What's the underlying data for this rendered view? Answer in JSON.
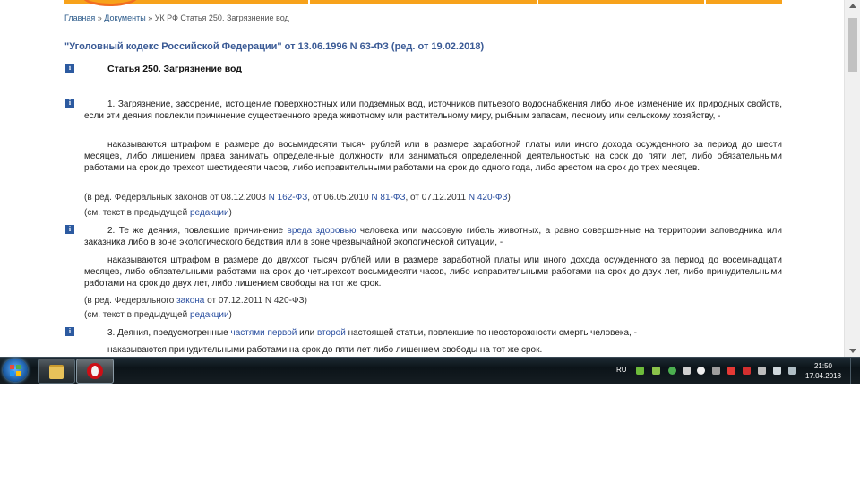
{
  "breadcrumb": {
    "home": "Главная",
    "sep1": " » ",
    "documents": "Документы",
    "sep2": " » ",
    "current": "УК РФ Статья 250. Загрязнение вод"
  },
  "doc_title": "\"Уголовный кодекс Российской Федерации\" от 13.06.1996 N 63-ФЗ (ред. от 19.02.2018)",
  "article_title": "Статья 250. Загрязнение вод",
  "p1": "1. Загрязнение, засорение, истощение поверхностных или подземных вод, источников питьевого водоснабжения либо иное изменение их природных свойств, если эти деяния повлекли причинение существенного вреда животному или растительному миру, рыбным запасам, лесному или сельскому хозяйству, -",
  "p1_sanction": "наказываются штрафом в размере до восьмидесяти тысяч рублей или в размере заработной платы или иного дохода осужденного за период до шести месяцев, либо лишением права занимать определенные должности или заниматься определенной деятельностью на срок до пяти лет, либо обязательными работами на срок до трехсот шестидесяти часов, либо исправительными работами на срок до одного года, либо арестом на срок до трех месяцев.",
  "note1": {
    "prefix": "(в ред. Федеральных законов от 08.12.2003 ",
    "link1": "N 162-ФЗ",
    "mid1": ", от 06.05.2010 ",
    "link2": "N 81-ФЗ",
    "mid2": ", от 07.12.2011 ",
    "link3": "N 420-ФЗ",
    "suffix": ")"
  },
  "see1": {
    "prefix": "(см. текст в предыдущей ",
    "link": "редакции",
    "suffix": ")"
  },
  "p2": {
    "prefix": "2. Те же деяния, повлекшие причинение ",
    "link": "вреда здоровью",
    "suffix": " человека или массовую гибель животных, а равно совершенные на территории заповедника или заказника либо в зоне экологического бедствия или в зоне чрезвычайной экологической ситуации, -"
  },
  "p2_sanction": "наказываются штрафом в размере до двухсот тысяч рублей или в размере заработной платы или иного дохода осужденного за период до восемнадцати месяцев, либо обязательными работами на срок до четырехсот восьмидесяти часов, либо исправительными работами на срок до двух лет, либо принудительными работами на срок до двух лет, либо лишением свободы на тот же срок.",
  "note2": {
    "prefix": "(в ред. Федерального ",
    "link": "закона",
    "suffix": " от 07.12.2011 N 420-ФЗ)"
  },
  "see2": {
    "prefix": "(см. текст в предыдущей ",
    "link": "редакции",
    "suffix": ")"
  },
  "p3": {
    "prefix": "3. Деяния, предусмотренные ",
    "link1": "частями первой",
    "mid": " или ",
    "link2": "второй",
    "suffix": " настоящей статьи, повлекшие по неосторожности смерть человека, -"
  },
  "p3_sanction": "наказываются принудительными работами на срок до пяти лет либо лишением свободы на тот же срок.",
  "info_icon_glyph": "i",
  "taskbar": {
    "language": "RU",
    "time": "21:50",
    "date": "17.04.2018"
  },
  "colors": {
    "accent_orange": "#f7a21b",
    "link_blue": "#2a4fa0",
    "title_blue": "#3a5a95",
    "info_icon": "#2c5aa0"
  }
}
